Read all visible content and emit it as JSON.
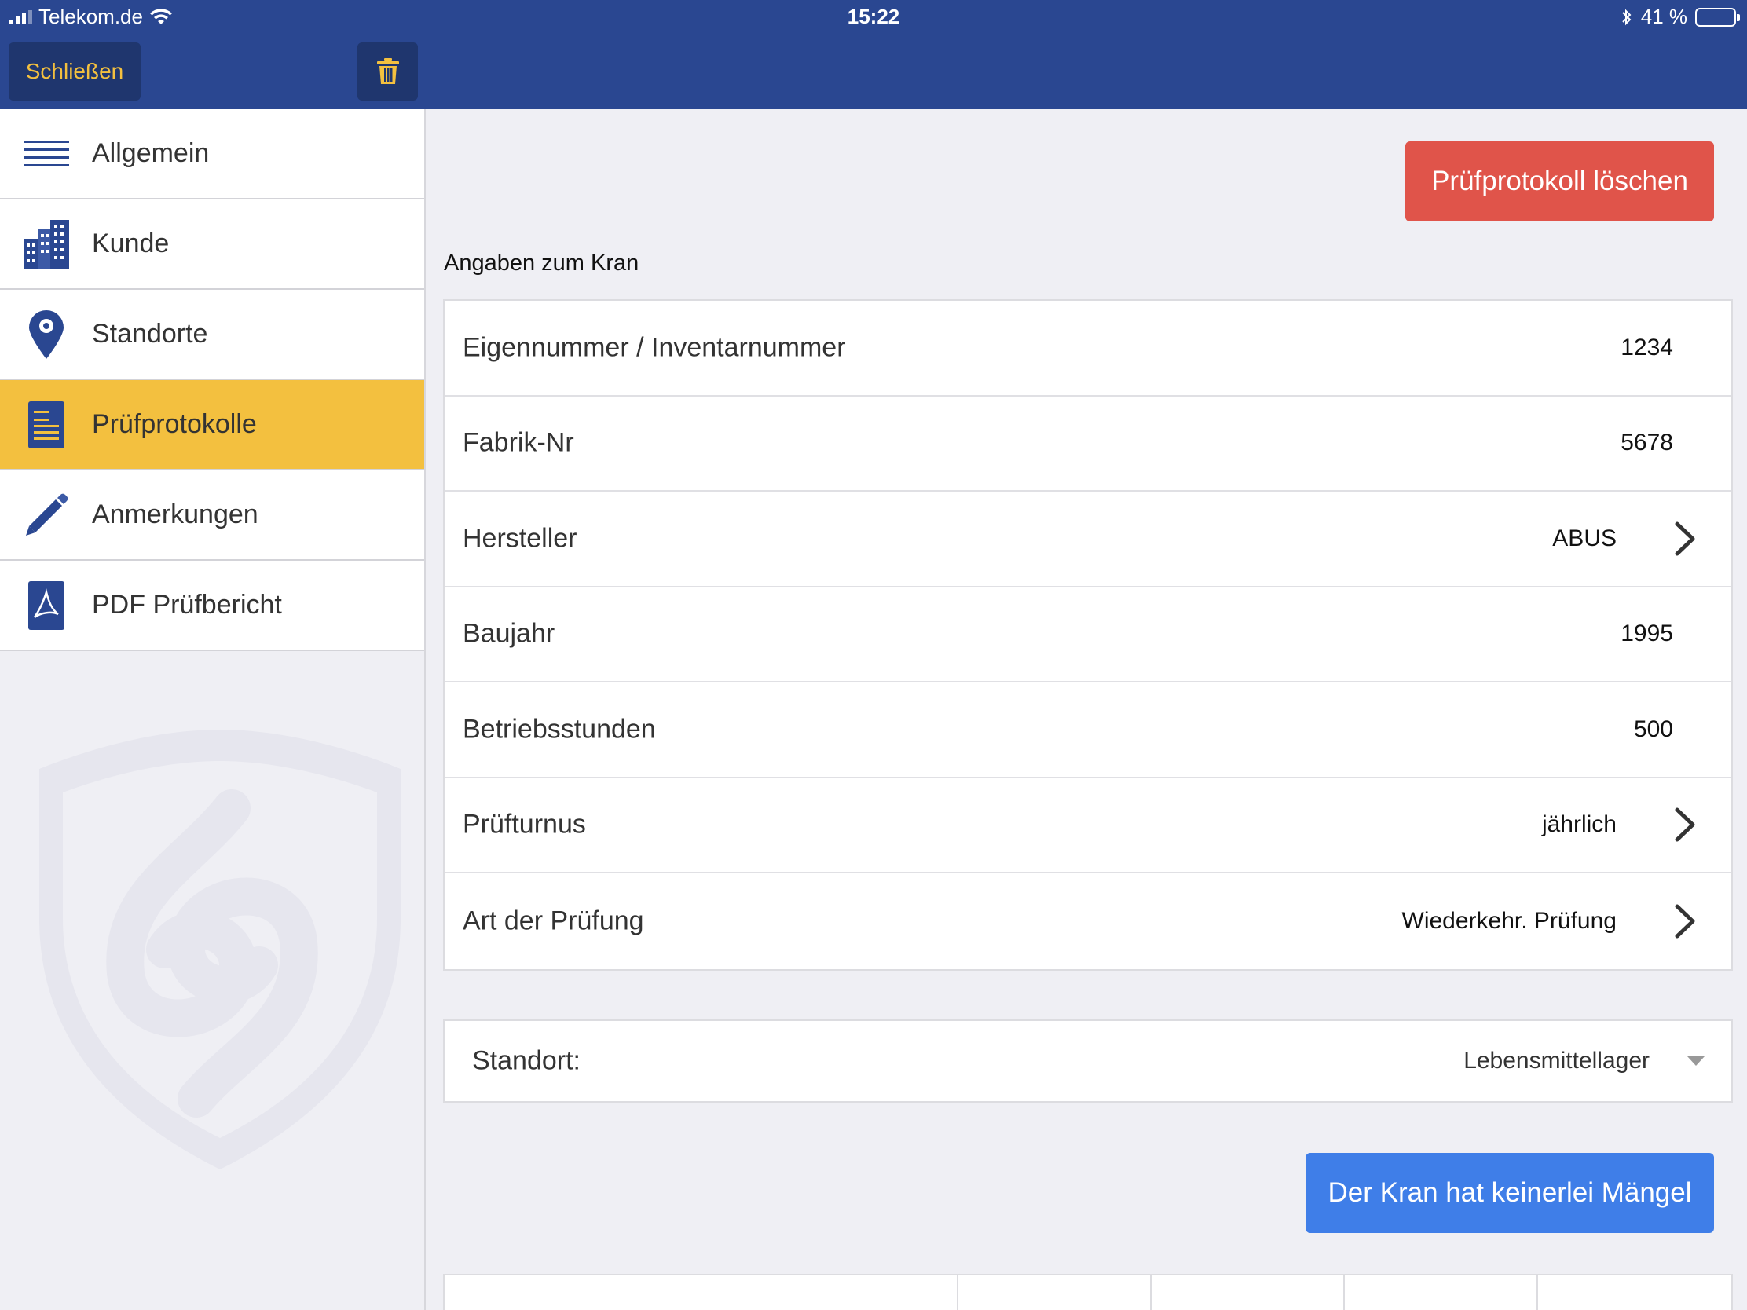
{
  "status_bar": {
    "carrier": "Telekom.de",
    "time": "15:22",
    "battery_percent": "41 %",
    "battery_level": 0.41
  },
  "nav": {
    "close_label": "Schließen",
    "trash_icon": "trash-icon"
  },
  "sidebar": {
    "items": [
      {
        "label": "Allgemein",
        "icon": "list-icon",
        "active": false
      },
      {
        "label": "Kunde",
        "icon": "buildings-icon",
        "active": false
      },
      {
        "label": "Standorte",
        "icon": "map-pin-icon",
        "active": false
      },
      {
        "label": "Prüfprotokolle",
        "icon": "document-icon",
        "active": true
      },
      {
        "label": "Anmerkungen",
        "icon": "pencil-icon",
        "active": false
      },
      {
        "label": "PDF Prüfbericht",
        "icon": "pdf-icon",
        "active": false
      }
    ]
  },
  "main": {
    "delete_button": "Prüfprotokoll löschen",
    "section_title": "Angaben zum Kran",
    "fields": [
      {
        "label": "Eigennummer / Inventarnummer",
        "value": "1234",
        "chevron": false
      },
      {
        "label": "Fabrik-Nr",
        "value": "5678",
        "chevron": false
      },
      {
        "label": "Hersteller",
        "value": "ABUS",
        "chevron": true
      },
      {
        "label": "Baujahr",
        "value": "1995",
        "chevron": false
      },
      {
        "label": "Betriebsstunden",
        "value": "500",
        "chevron": false
      },
      {
        "label": "Prüfturnus",
        "value": "jährlich",
        "chevron": true
      },
      {
        "label": "Art der Prüfung",
        "value": "Wiederkehr. Prüfung",
        "chevron": true
      }
    ],
    "standort": {
      "label": "Standort:",
      "value": "Lebensmittellager"
    },
    "no_defects_button": "Der Kran hat keinerlei Mängel"
  },
  "colors": {
    "nav_bg": "#2a4791",
    "accent_yellow": "#f3c03f",
    "delete_red": "#e0544a",
    "primary_blue": "#3f7ee8",
    "icon_blue": "#2a4791"
  }
}
